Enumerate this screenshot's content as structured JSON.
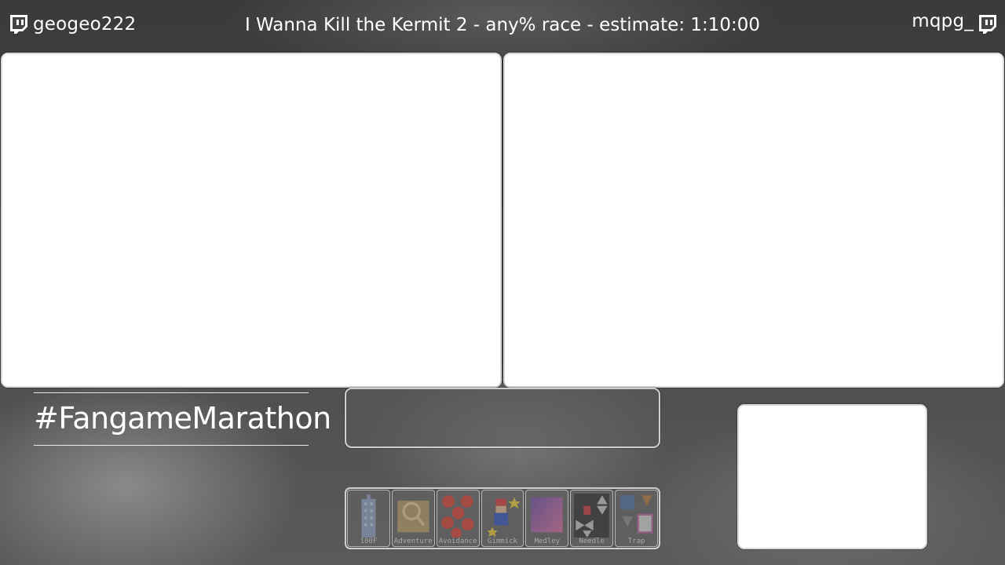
{
  "header": {
    "left_runner": {
      "name": "geogeo222",
      "icon": "twitch-icon"
    },
    "title": "I Wanna Kill the Kermit 2 - any% race - estimate: 1:10:00",
    "right_runner": {
      "name": "mqpg_",
      "icon": "twitch-icon"
    }
  },
  "hashtag": "#FangameMarathon",
  "categories": [
    {
      "label": "100F",
      "icon": "building-icon"
    },
    {
      "label": "Adventure",
      "icon": "map-icon"
    },
    {
      "label": "Avoidance",
      "icon": "cherries-icon"
    },
    {
      "label": "Gimmick",
      "icon": "mario-star-icon"
    },
    {
      "label": "Medley",
      "icon": "gradient-square-icon"
    },
    {
      "label": "Needle",
      "icon": "spikes-icon"
    },
    {
      "label": "Trap",
      "icon": "trap-icon"
    }
  ],
  "colors": {
    "background": "#4a4a4a",
    "panel_fill": "#ffffff",
    "panel_border": "#d9d9d9",
    "text": "#ffffff"
  }
}
